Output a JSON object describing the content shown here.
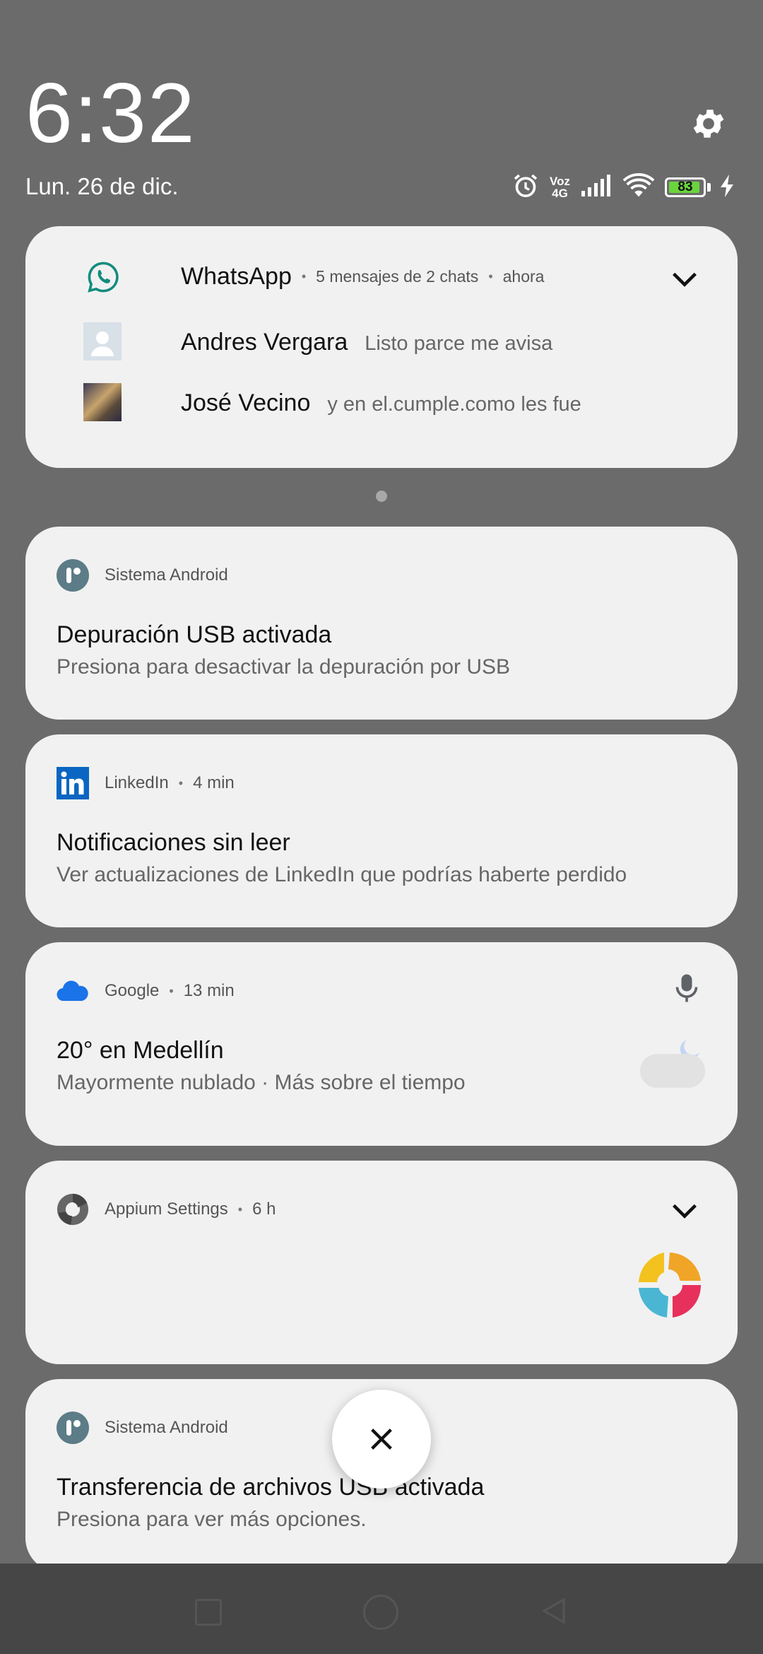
{
  "header": {
    "time": "6:32",
    "date": "Lun. 26 de dic."
  },
  "status": {
    "network_top": "Voz",
    "network_bottom": "4G",
    "battery": "83"
  },
  "whatsapp": {
    "app": "WhatsApp",
    "summary": "5 mensajes de 2 chats",
    "time": "ahora",
    "messages": [
      {
        "sender": "Andres Vergara",
        "text": "Listo parce me avisa"
      },
      {
        "sender": "José Vecino",
        "text": "y en el.cumple.como les fue"
      }
    ]
  },
  "notifications": [
    {
      "app": "Sistema Android",
      "time": "",
      "title": "Depuración USB activada",
      "body": "Presiona para desactivar la depuración por USB"
    },
    {
      "app": "LinkedIn",
      "time": "4 min",
      "title": "Notificaciones sin leer",
      "body": "Ver actualizaciones de LinkedIn que podrías haberte perdido"
    },
    {
      "app": "Google",
      "time": "13 min",
      "title": "20° en Medellín",
      "body": "Mayormente nublado · Más sobre el tiempo"
    },
    {
      "app": "Appium Settings",
      "time": "6 h",
      "title": "",
      "body": ""
    },
    {
      "app": "Sistema Android",
      "time": "",
      "title": "Transferencia de archivos USB activada",
      "body": "Presiona para ver más opciones."
    }
  ],
  "icons": {
    "settings": "gear-icon",
    "alarm": "alarm-icon",
    "signal": "signal-icon",
    "wifi": "wifi-icon",
    "charging": "charging-icon",
    "expand": "chevron-down-icon",
    "close": "close-icon",
    "mic": "microphone-icon"
  },
  "colors": {
    "whatsapp": "#128c7e",
    "linkedin": "#0a66c2",
    "google_cloud": "#1a73e8",
    "android": "#5c7c87"
  }
}
